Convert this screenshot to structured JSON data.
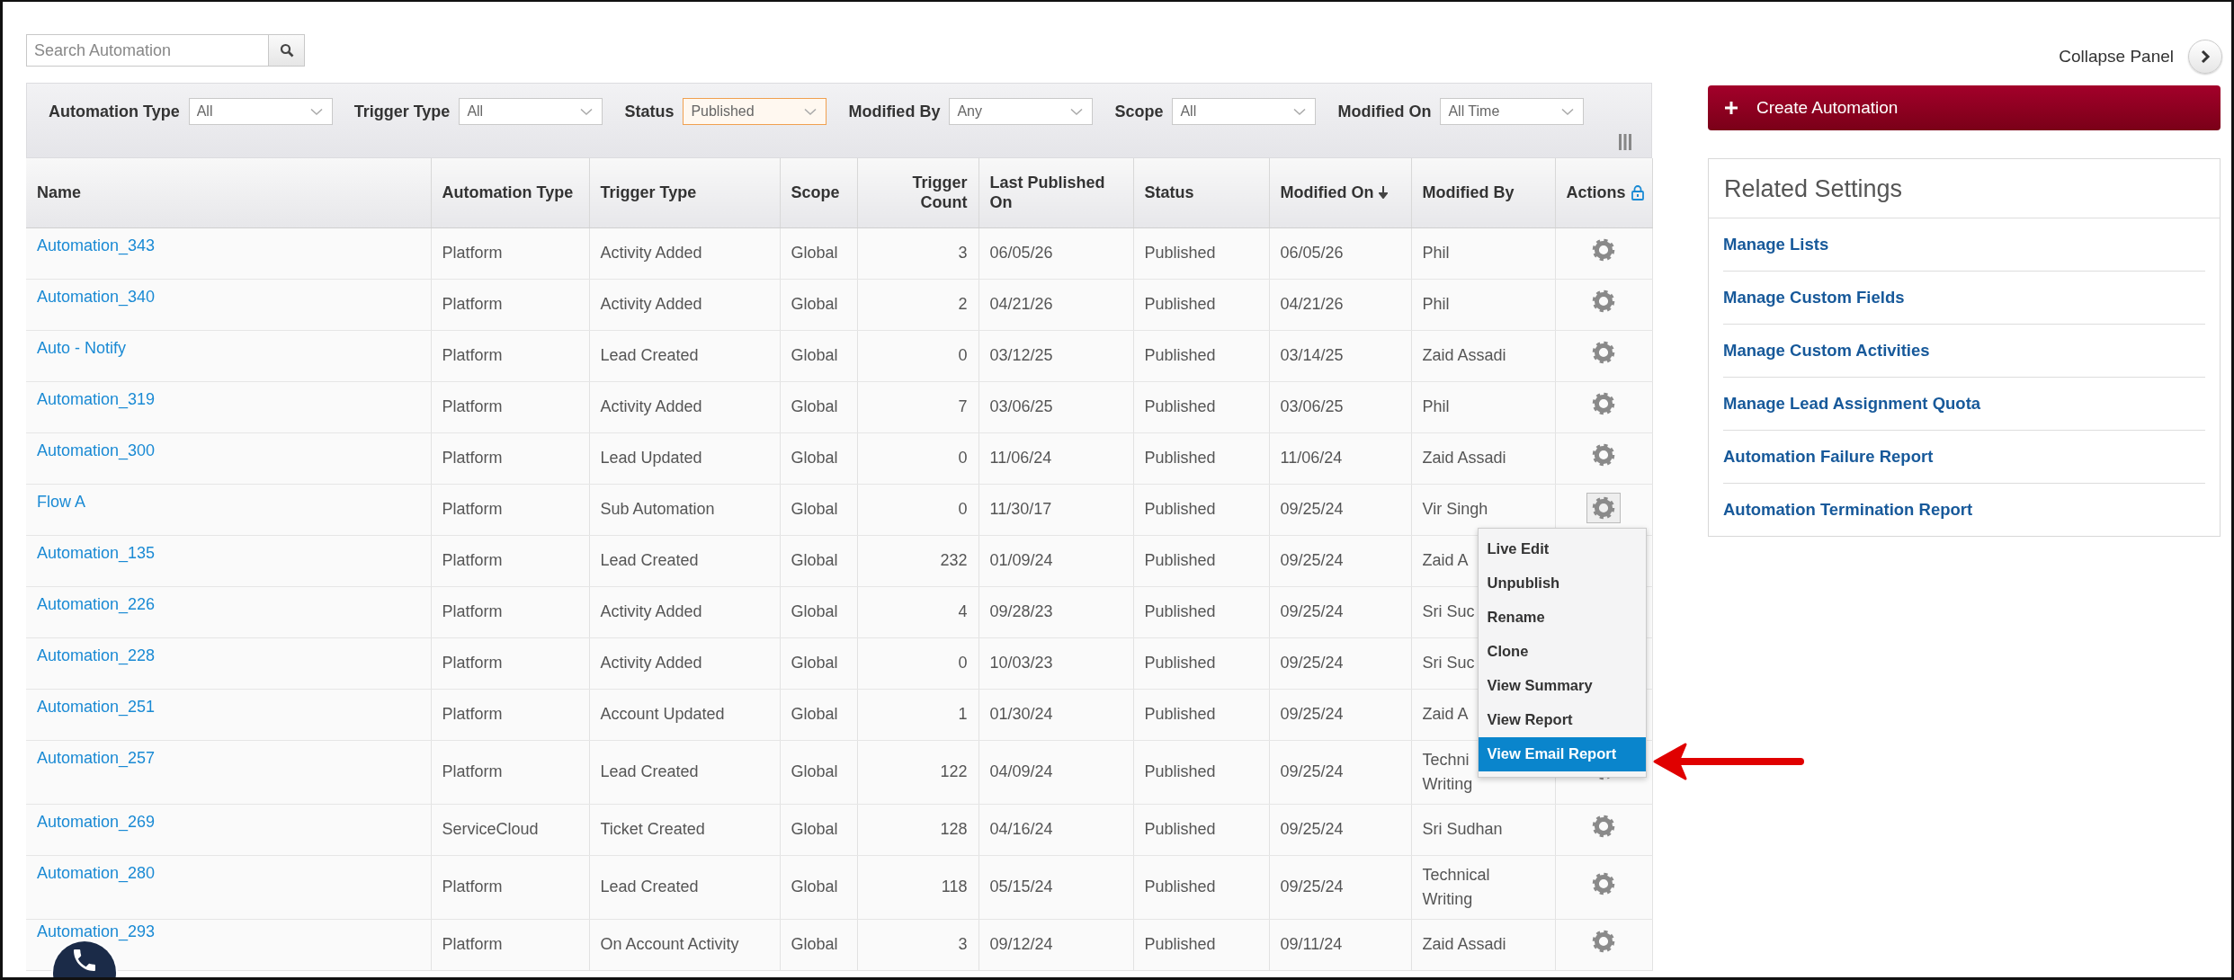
{
  "search": {
    "placeholder": "Search Automation"
  },
  "filters": [
    {
      "label": "Automation Type",
      "value": "All",
      "highlighted": false
    },
    {
      "label": "Trigger Type",
      "value": "All",
      "highlighted": false
    },
    {
      "label": "Status",
      "value": "Published",
      "highlighted": true
    },
    {
      "label": "Modified By",
      "value": "Any",
      "highlighted": false
    },
    {
      "label": "Scope",
      "value": "All",
      "highlighted": false
    },
    {
      "label": "Modified On",
      "value": "All Time",
      "highlighted": false
    }
  ],
  "table": {
    "columns": [
      {
        "label": "Name",
        "kind": "plain"
      },
      {
        "label": "Automation Type",
        "kind": "plain"
      },
      {
        "label": "Trigger Type",
        "kind": "plain"
      },
      {
        "label": "Scope",
        "kind": "plain"
      },
      {
        "label": "Trigger Count",
        "kind": "plain"
      },
      {
        "label": "Last Published On",
        "kind": "plain"
      },
      {
        "label": "Status",
        "kind": "plain"
      },
      {
        "label": "Modified On",
        "kind": "sorted"
      },
      {
        "label": "Modified By",
        "kind": "plain"
      },
      {
        "label": "Actions",
        "kind": "locked"
      }
    ],
    "rows": [
      {
        "name": "Automation_343",
        "automation_type": "Platform",
        "trigger_type": "Activity Added",
        "scope": "Global",
        "trigger_count": "3",
        "last_published_on": "06/05/26",
        "status": "Published",
        "modified_on": "06/05/26",
        "modified_by": "Phil",
        "menu_open": false
      },
      {
        "name": "Automation_340",
        "automation_type": "Platform",
        "trigger_type": "Activity Added",
        "scope": "Global",
        "trigger_count": "2",
        "last_published_on": "04/21/26",
        "status": "Published",
        "modified_on": "04/21/26",
        "modified_by": "Phil",
        "menu_open": false
      },
      {
        "name": "Auto - Notify",
        "automation_type": "Platform",
        "trigger_type": "Lead Created",
        "scope": "Global",
        "trigger_count": "0",
        "last_published_on": "03/12/25",
        "status": "Published",
        "modified_on": "03/14/25",
        "modified_by": "Zaid Assadi",
        "menu_open": false
      },
      {
        "name": "Automation_319",
        "automation_type": "Platform",
        "trigger_type": "Activity Added",
        "scope": "Global",
        "trigger_count": "7",
        "last_published_on": "03/06/25",
        "status": "Published",
        "modified_on": "03/06/25",
        "modified_by": "Phil",
        "menu_open": false
      },
      {
        "name": "Automation_300",
        "automation_type": "Platform",
        "trigger_type": "Lead Updated",
        "scope": "Global",
        "trigger_count": "0",
        "last_published_on": "11/06/24",
        "status": "Published",
        "modified_on": "11/06/24",
        "modified_by": "Zaid Assadi",
        "menu_open": false
      },
      {
        "name": "Flow A",
        "automation_type": "Platform",
        "trigger_type": "Sub Automation",
        "scope": "Global",
        "trigger_count": "0",
        "last_published_on": "11/30/17",
        "status": "Published",
        "modified_on": "09/25/24",
        "modified_by": "Vir Singh",
        "menu_open": true
      },
      {
        "name": "Automation_135",
        "automation_type": "Platform",
        "trigger_type": "Lead Created",
        "scope": "Global",
        "trigger_count": "232",
        "last_published_on": "01/09/24",
        "status": "Published",
        "modified_on": "09/25/24",
        "modified_by": "Zaid A",
        "menu_open": false
      },
      {
        "name": "Automation_226",
        "automation_type": "Platform",
        "trigger_type": "Activity Added",
        "scope": "Global",
        "trigger_count": "4",
        "last_published_on": "09/28/23",
        "status": "Published",
        "modified_on": "09/25/24",
        "modified_by": "Sri Suc",
        "menu_open": false
      },
      {
        "name": "Automation_228",
        "automation_type": "Platform",
        "trigger_type": "Activity Added",
        "scope": "Global",
        "trigger_count": "0",
        "last_published_on": "10/03/23",
        "status": "Published",
        "modified_on": "09/25/24",
        "modified_by": "Sri Suc",
        "menu_open": false
      },
      {
        "name": "Automation_251",
        "automation_type": "Platform",
        "trigger_type": "Account Updated",
        "scope": "Global",
        "trigger_count": "1",
        "last_published_on": "01/30/24",
        "status": "Published",
        "modified_on": "09/25/24",
        "modified_by": "Zaid A",
        "menu_open": false
      },
      {
        "name": "Automation_257",
        "automation_type": "Platform",
        "trigger_type": "Lead Created",
        "scope": "Global",
        "trigger_count": "122",
        "last_published_on": "04/09/24",
        "status": "Published",
        "modified_on": "09/25/24",
        "modified_by": "Techni Writing",
        "menu_open": false
      },
      {
        "name": "Automation_269",
        "automation_type": "ServiceCloud",
        "trigger_type": "Ticket Created",
        "scope": "Global",
        "trigger_count": "128",
        "last_published_on": "04/16/24",
        "status": "Published",
        "modified_on": "09/25/24",
        "modified_by": "Sri Sudhan",
        "menu_open": false
      },
      {
        "name": "Automation_280",
        "automation_type": "Platform",
        "trigger_type": "Lead Created",
        "scope": "Global",
        "trigger_count": "118",
        "last_published_on": "05/15/24",
        "status": "Published",
        "modified_on": "09/25/24",
        "modified_by": "Technical Writing",
        "menu_open": false
      },
      {
        "name": "Automation_293",
        "automation_type": "Platform",
        "trigger_type": "On Account Activity",
        "scope": "Global",
        "trigger_count": "3",
        "last_published_on": "09/12/24",
        "status": "Published",
        "modified_on": "09/11/24",
        "modified_by": "Zaid Assadi",
        "menu_open": false
      }
    ]
  },
  "actions_menu": {
    "items": [
      {
        "label": "Live Edit",
        "selected": false
      },
      {
        "label": "Unpublish",
        "selected": false
      },
      {
        "label": "Rename",
        "selected": false
      },
      {
        "label": "Clone",
        "selected": false
      },
      {
        "label": "View Summary",
        "selected": false
      },
      {
        "label": "View Report",
        "selected": false
      },
      {
        "label": "View Email Report",
        "selected": true
      }
    ]
  },
  "side_panel": {
    "collapse_label": "Collapse Panel",
    "create_button": "Create Automation",
    "related_settings": {
      "title": "Related Settings",
      "links": [
        "Manage Lists",
        "Manage Custom Fields",
        "Manage Custom Activities",
        "Manage Lead Assignment Quota",
        "Automation Failure Report",
        "Automation Termination Report"
      ]
    }
  }
}
